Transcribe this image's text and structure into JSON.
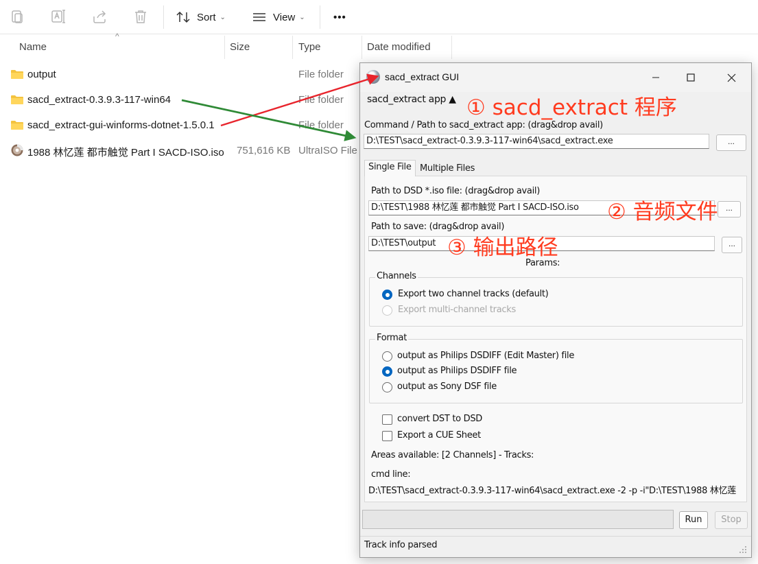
{
  "explorer": {
    "toolbar": {
      "sort_label": "Sort",
      "view_label": "View",
      "more_label": "•••"
    },
    "columns": {
      "name": "Name",
      "size": "Size",
      "type": "Type",
      "date": "Date modified"
    },
    "files": [
      {
        "name": "output",
        "size": "",
        "type": "File folder",
        "icon": "folder-icon"
      },
      {
        "name": "sacd_extract-0.3.9.3-117-win64",
        "size": "",
        "type": "File folder",
        "icon": "folder-icon"
      },
      {
        "name": "sacd_extract-gui-winforms-dotnet-1.5.0.1",
        "size": "",
        "type": "File folder",
        "icon": "folder-icon"
      },
      {
        "name": "1988 林忆莲 都市触觉 Part I SACD-ISO.iso",
        "size": "751,616 KB",
        "type": "UltraISO File",
        "icon": "disc-image-icon"
      }
    ]
  },
  "gui": {
    "title": "sacd_extract GUI",
    "app_section": "sacd_extract app ▲",
    "command_label": "Command / Path to sacd_extract app: (drag&drop avail)",
    "command_value": "D:\\TEST\\sacd_extract-0.3.9.3-117-win64\\sacd_extract.exe",
    "browse_label": "...",
    "tabs": [
      "Single File",
      "Multiple Files"
    ],
    "dsd_label": "Path to DSD *.iso file: (drag&drop avail)",
    "dsd_value": "D:\\TEST\\1988 林忆莲 都市触觉 Part I SACD-ISO.iso",
    "save_label": "Path to save: (drag&drop avail)",
    "save_value": "D:\\TEST\\output",
    "params_label": "Params:",
    "channels": {
      "title": "Channels",
      "options": [
        {
          "label": "Export two channel tracks (default)",
          "selected": true,
          "enabled": true
        },
        {
          "label": "Export multi-channel tracks",
          "selected": false,
          "enabled": false
        }
      ]
    },
    "format": {
      "title": "Format",
      "options": [
        {
          "label": "output as Philips DSDIFF (Edit Master) file",
          "selected": false
        },
        {
          "label": "output as Philips DSDIFF file",
          "selected": true
        },
        {
          "label": "output as Sony DSF file",
          "selected": false
        }
      ]
    },
    "checkboxes": [
      {
        "label": "convert DST to DSD",
        "checked": false
      },
      {
        "label": "Export a CUE Sheet",
        "checked": false
      }
    ],
    "areas_text": "Areas available: [2 Channels] - Tracks:",
    "cmd_label": "cmd line:",
    "cmd_value": "D:\\TEST\\sacd_extract-0.3.9.3-117-win64\\sacd_extract.exe -2 -p  -i\"D:\\TEST\\1988 林忆莲",
    "run_label": "Run",
    "stop_label": "Stop",
    "status_text": "Track info parsed"
  },
  "annotations": {
    "a1": "① sacd_extract 程序",
    "a2": "② 音频文件",
    "a3": "③ 输出路径"
  },
  "colors": {
    "accent_blue": "#0067c0",
    "annotation_red": "#ff3b1f",
    "arrow_red": "#e8242c",
    "arrow_green": "#2f8a36",
    "folder_yellow": "#f4c33f"
  }
}
